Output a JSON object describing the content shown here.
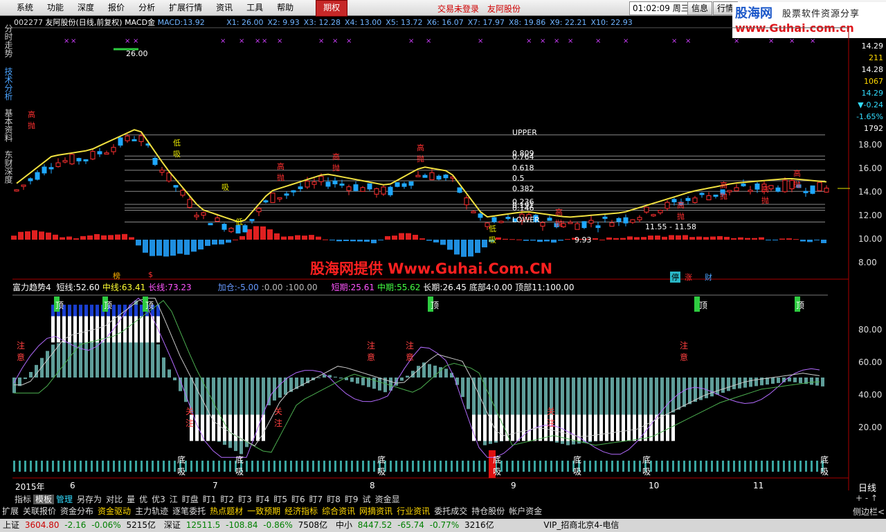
{
  "menu": [
    "系统",
    "功能",
    "深度",
    "报价",
    "分析",
    "扩展行情",
    "资讯",
    "工具",
    "帮助",
    "期权"
  ],
  "menu_notice": [
    "交易未登录",
    "友阿股份"
  ],
  "clock": {
    "time": "01:02:09",
    "weekday": "周三"
  },
  "sys_buttons": [
    "信息",
    "行情"
  ],
  "logo": {
    "brand": "股海网",
    "slogan": "股票软件资源分享",
    "url": "www.Guhai.com.cn"
  },
  "side_tabs": [
    "分时走势",
    "技术分析",
    "基本资料",
    "东财深度"
  ],
  "stock": {
    "code": "002277",
    "name": "友阿股份",
    "period": "(日线,前复权)",
    "indicator": "MACD金",
    "macd_label": "MACD:",
    "macd_value": "13.92"
  },
  "x_params": [
    {
      "k": "X1:",
      "v": "26.00"
    },
    {
      "k": "X2:",
      "v": "9.93"
    },
    {
      "k": "X3:",
      "v": "12.28"
    },
    {
      "k": "X4:",
      "v": "13.00"
    },
    {
      "k": "X5:",
      "v": "13.72"
    },
    {
      "k": "X6:",
      "v": "16.07"
    },
    {
      "k": "X7:",
      "v": "17.97"
    },
    {
      "k": "X8:",
      "v": "19.86"
    },
    {
      "k": "X9:",
      "v": "22.21"
    },
    {
      "k": "X10:",
      "v": "22.93"
    }
  ],
  "price_axis": [
    "18.00",
    "16.00",
    "14.00",
    "12.00",
    "10.00",
    "8.00"
  ],
  "right_info": {
    "price1": "14.29",
    "vol1": "211",
    "price2": "14.28",
    "vol2": "1067",
    "price3": "14.29",
    "change": "▼-0.24",
    "pct": "-1.65%",
    "vol3": "1792"
  },
  "fib_levels": [
    {
      "label": "UPPER",
      "value": 18.9
    },
    {
      "label": "0.809",
      "value": 17.1
    },
    {
      "label": "0.764",
      "value": 16.8
    },
    {
      "label": "0.618",
      "value": 15.9
    },
    {
      "label": "0.5",
      "value": 15.0
    },
    {
      "label": "0.382",
      "value": 14.1
    },
    {
      "label": "0.236",
      "value": 13.0
    },
    {
      "label": "0.191",
      "value": 12.7
    },
    {
      "label": "0.146",
      "value": 12.5
    },
    {
      "label": "LOWER",
      "value": 11.5
    }
  ],
  "price_annotations": [
    {
      "text": "26.00"
    },
    {
      "text": "9.93"
    },
    {
      "text": "11.55 - 11.58"
    }
  ],
  "signals_top": [
    "高抛",
    "低吸",
    "吸",
    "低",
    "高抛",
    "高抛",
    "高抛",
    "低吸",
    "高抛",
    "高抛",
    "高抛",
    "高抛",
    "高抛"
  ],
  "bottom_badges": [
    "榜",
    "$",
    "停",
    "涨",
    "财"
  ],
  "watermark": "股海网提供 Www.Guhai.Com.CN",
  "indicator": {
    "name": "富力趋势4",
    "items": [
      {
        "k": "短线:",
        "v": "52.60",
        "c": "#ffffff"
      },
      {
        "k": "中线:",
        "v": "63.41",
        "c": "#ffff33"
      },
      {
        "k": "长线:",
        "v": "73.23",
        "c": "#ff55ff"
      },
      {
        "k": "加仓:",
        "v": "-5.00",
        "c": "#6699ff"
      },
      {
        "k": ":",
        "v": "0.00",
        "c": "#bbbbbb"
      },
      {
        "k": ":",
        "v": "100.00",
        "c": "#bbbbbb"
      },
      {
        "k": "短期:",
        "v": "25.61",
        "c": "#ff55ff"
      },
      {
        "k": "中期:",
        "v": "55.62",
        "c": "#44ff44"
      },
      {
        "k": "长期:",
        "v": "26.45",
        "c": "#ffffff"
      },
      {
        "k": "底部4:",
        "v": "0.00",
        "c": "#ffffff"
      },
      {
        "k": "顶部11:",
        "v": "100.00",
        "c": "#ffffff"
      }
    ],
    "axis": [
      "80.00",
      "60.00",
      "40.00",
      "20.00"
    ],
    "labels": {
      "top": "顶",
      "watch": "关注",
      "note": "注意",
      "bottom": "底吸"
    }
  },
  "date_axis": {
    "year": "2015年",
    "months": [
      "6",
      "7",
      "8",
      "9",
      "10",
      "11"
    ],
    "period": "日线"
  },
  "bottom_tabs": [
    "指标",
    "模板",
    "管理",
    "另存为",
    "对比",
    "量",
    "优",
    "优3",
    "江",
    "盯盘",
    "盯1",
    "盯2",
    "盯3",
    "盯4",
    "盯5",
    "盯6",
    "盯7",
    "盯8",
    "盯9",
    "试",
    "资金显"
  ],
  "func_tabs": [
    "扩展",
    "关联报价",
    "资金分布",
    "资金驱动",
    "主力轨迹",
    "逐笔委托",
    "热点题材",
    "一致预期",
    "经济指标",
    "综合资讯",
    "网摘资讯",
    "行业资讯",
    "委托成交",
    "持仓股份",
    "帐户资金"
  ],
  "sidebar_hint": "侧边栏<",
  "status": {
    "sh": {
      "name": "上证",
      "value": "3604.80",
      "chg": "-2.16",
      "pct": "-0.06%",
      "vol": "5215亿"
    },
    "sz": {
      "name": "深证",
      "value": "12511.5",
      "chg": "-108.84",
      "pct": "-0.86%",
      "vol": "7508亿"
    },
    "zx": {
      "name": "中小",
      "value": "8447.52",
      "chg": "-65.74",
      "pct": "-0.77%",
      "vol": "3216亿"
    },
    "vip": "VIP_招商北京4-电信"
  }
}
